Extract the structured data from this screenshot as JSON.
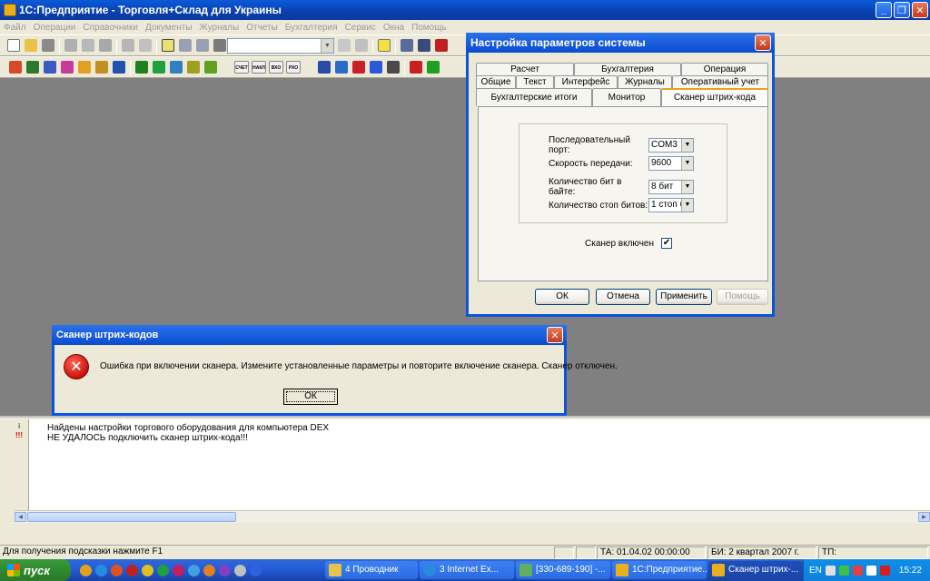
{
  "app": {
    "title": "1С:Предприятие - Торговля+Склад для Украины"
  },
  "menu": [
    "Файл",
    "Операции",
    "Справочники",
    "Документы",
    "Журналы",
    "Отчеты",
    "Бухгалтерия",
    "Сервис",
    "Окна",
    "Помощь"
  ],
  "toolbar2": {
    "icon_labels": [
      "СЧЕТ",
      "НАКЛ",
      "ВХО",
      "РХО"
    ]
  },
  "settings_dialog": {
    "title": "Настройка параметров системы",
    "tabs_row1": [
      "Расчет",
      "Бухгалтерия",
      "Операция"
    ],
    "tabs_row2": [
      "Общие",
      "Текст",
      "Интерфейс",
      "Журналы",
      "Оперативный учет"
    ],
    "tabs_row3": [
      "Бухгалтерские итоги",
      "Монитор",
      "Сканер штрих-кода"
    ],
    "fields": [
      {
        "label": "Последовательный порт:",
        "value": "COM3"
      },
      {
        "label": "Скорость передачи:",
        "value": "9600"
      },
      {
        "label": "Количество бит в байте:",
        "value": "8 бит"
      },
      {
        "label": "Количество стоп битов:",
        "value": "1 стоп б"
      }
    ],
    "scanner_enabled_label": "Сканер включен",
    "scanner_enabled_mark": "✔",
    "buttons": {
      "ok": "ОК",
      "cancel": "Отмена",
      "apply": "Применить",
      "help": "Помощь"
    }
  },
  "error_dialog": {
    "title": "Сканер штрих-кодов",
    "message": "Ошибка при включении сканера. Измените установленные параметры и повторите включение сканера. Сканер отключен.",
    "ok": "ОК"
  },
  "messages": [
    "Найдены настройки торгового оборудования для компьютера DEX",
    "НЕ УДАЛОСЬ подключить сканер штрих-кода!!!"
  ],
  "status": {
    "hint": "Для получения подсказки нажмите F1",
    "ta": "ТА: 01.04.02  00:00:00",
    "bi": "БИ: 2 квартал 2007 г.",
    "tp": "ТП:"
  },
  "taskbar": {
    "start": "пуск",
    "tasks": [
      "4 Проводник",
      "3 Internet Ex...",
      "[330-689-190] -...",
      "1С:Предприятие...",
      "Сканер штрих-..."
    ],
    "lang": "EN",
    "clock": "15:22"
  }
}
